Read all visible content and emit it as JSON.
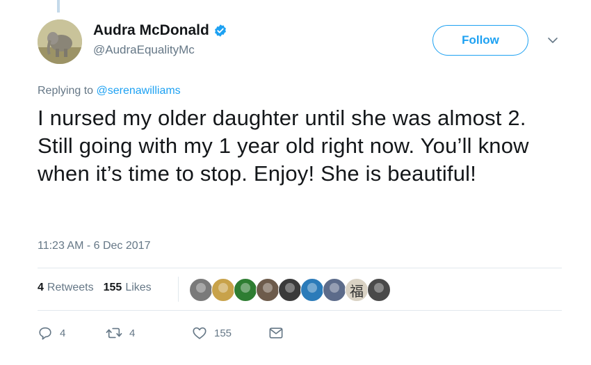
{
  "tweet": {
    "author_name": "Audra McDonald",
    "author_handle": "@AudraEqualityMc",
    "follow_label": "Follow",
    "replying_prefix": "Replying to",
    "replying_to": "@serenawilliams",
    "text": "I nursed my older daughter until she was almost 2. Still going with my 1 year old right now. You’ll know when it’s time to stop. Enjoy! She is beautiful!",
    "timestamp": "11:23 AM - 6 Dec 2017"
  },
  "stats": {
    "retweets_count": "4",
    "retweets_label": "Retweets",
    "likes_count": "155",
    "likes_label": "Likes"
  },
  "likers": [
    {
      "icon": "liker-avatar",
      "color": "#7a7a7a",
      "glyph": ""
    },
    {
      "icon": "liker-avatar",
      "color": "#c8a24a",
      "glyph": ""
    },
    {
      "icon": "liker-avatar",
      "color": "#2e7d32",
      "glyph": ""
    },
    {
      "icon": "liker-avatar",
      "color": "#6d5b4b",
      "glyph": ""
    },
    {
      "icon": "liker-avatar",
      "color": "#3a3a3a",
      "glyph": ""
    },
    {
      "icon": "liker-avatar",
      "color": "#2b7bb9",
      "glyph": ""
    },
    {
      "icon": "liker-avatar",
      "color": "#5c6b8a",
      "glyph": ""
    },
    {
      "icon": "liker-avatar",
      "color": "#d9d2c4",
      "glyph": "福"
    },
    {
      "icon": "liker-avatar",
      "color": "#4a4a4a",
      "glyph": ""
    }
  ],
  "actions": {
    "reply_count": "4",
    "retweet_count": "4",
    "like_count": "155"
  },
  "colors": {
    "accent": "#1da1f2",
    "secondary_text": "#657786",
    "text": "#14171a",
    "divider": "#e1e8ed"
  }
}
